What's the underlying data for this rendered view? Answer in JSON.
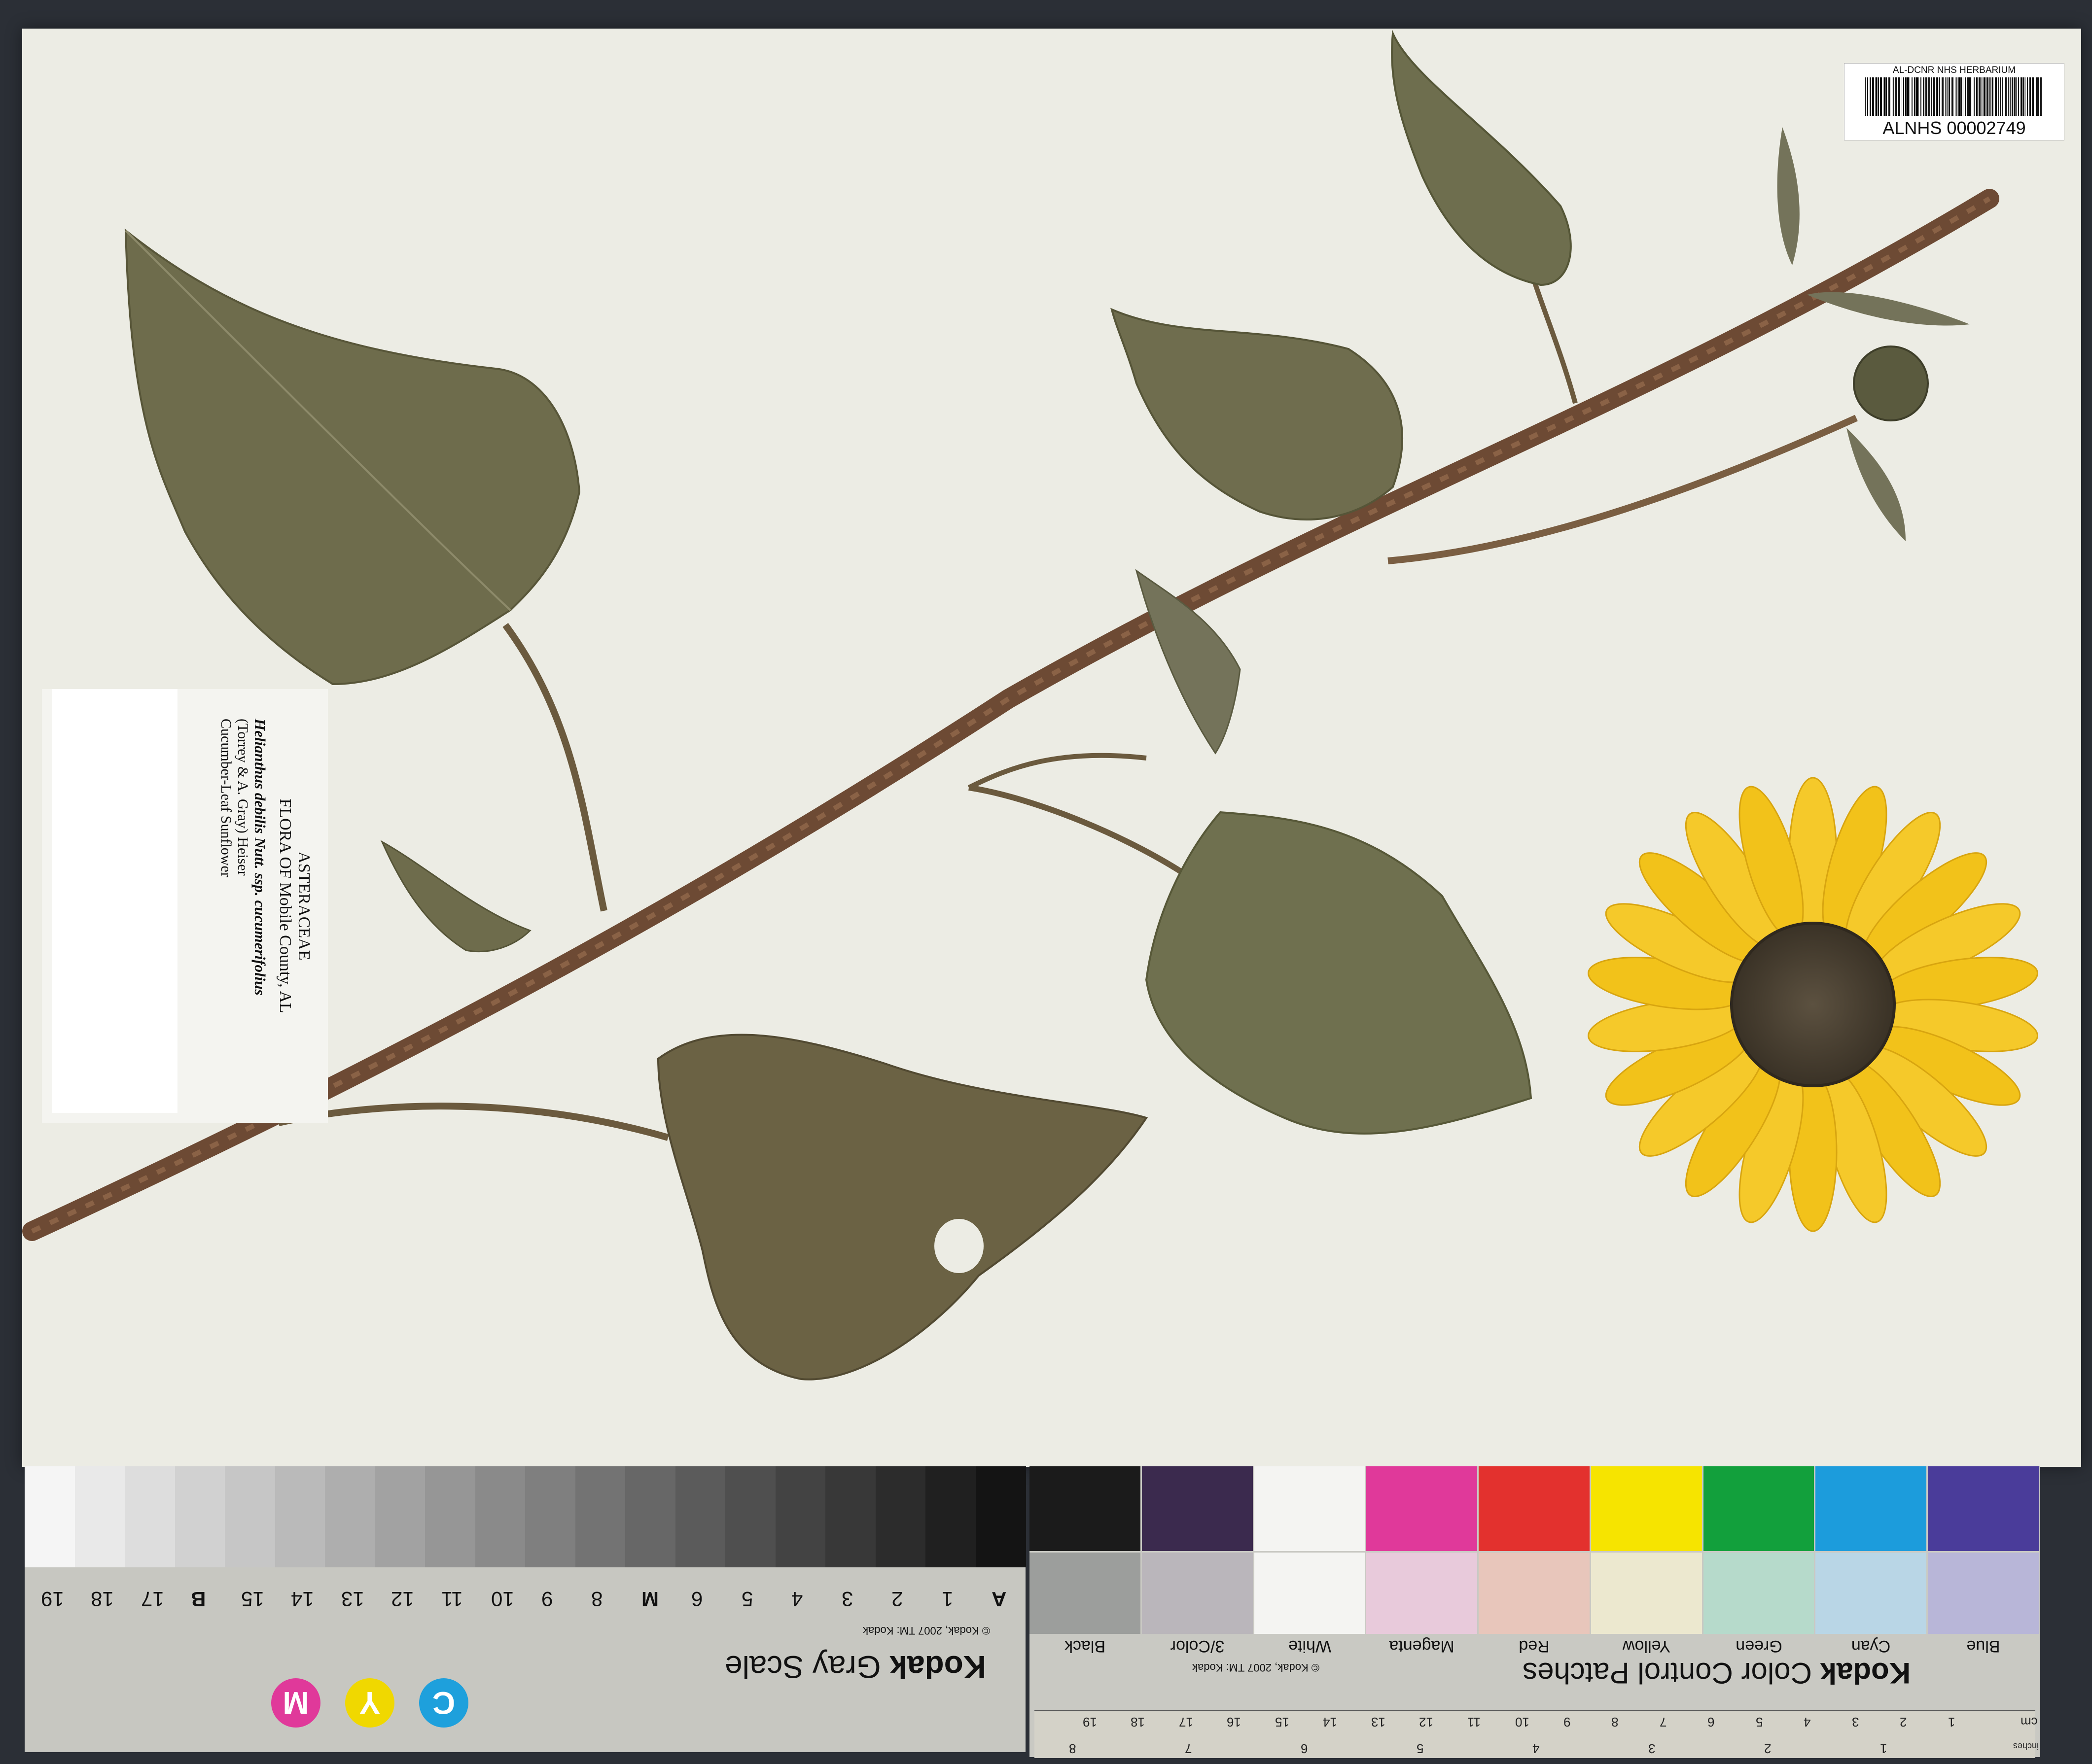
{
  "barcode": {
    "header": "AL-DCNR  NHS  HERBARIUM",
    "number": "ALNHS  00002749"
  },
  "label": {
    "family": "ASTERACEAE",
    "flora": "FLORA OF Mobile County, AL",
    "taxon": "Helianthus debilis Nutt. ssp. cucumerifolius",
    "authors": "(Torrey & A. Gray) Heiser",
    "common_name": "Cucumber-Leaf Sunflower"
  },
  "gray_scale": {
    "brand": "Kodak",
    "title": "Gray Scale",
    "copyright": "© Kodak, 2007 TM: Kodak",
    "steps": [
      "A",
      "1",
      "2",
      "3",
      "4",
      "5",
      "6",
      "M",
      "8",
      "9",
      "10",
      "11",
      "12",
      "13",
      "14",
      "15",
      "B",
      "17",
      "18",
      "19"
    ],
    "cmy": [
      "C",
      "Y",
      "M"
    ]
  },
  "color_patches": {
    "brand": "Kodak",
    "title": "Color Control Patches",
    "copyright": "© Kodak, 2007 TM: Kodak",
    "names": [
      "Blue",
      "Cyan",
      "Green",
      "Yellow",
      "Red",
      "Magenta",
      "White",
      "3/Color",
      "Black"
    ],
    "colors": [
      "#4a3c9a",
      "#1c9cdc",
      "#12a03c",
      "#f6e400",
      "#e3312e",
      "#e0399a",
      "#f4f4f2",
      "#3b2a4e",
      "#1b1b1b"
    ],
    "light_colors": [
      "#b8b6d8",
      "#b9d6e6",
      "#b6dacb",
      "#ece8cf",
      "#e8c6bb",
      "#e8cadb",
      "#f4f4f2",
      "#bab6bb",
      "#9c9e9c"
    ]
  },
  "ruler": {
    "unit_cm": "cm",
    "unit_in": "inches",
    "cm_marks": [
      "1",
      "2",
      "3",
      "4",
      "5",
      "6",
      "7",
      "8",
      "9",
      "10",
      "11",
      "12",
      "13",
      "14",
      "15",
      "16",
      "17",
      "18",
      "19"
    ],
    "in_marks": [
      "1",
      "2",
      "3",
      "4",
      "5",
      "6",
      "7",
      "8"
    ]
  }
}
